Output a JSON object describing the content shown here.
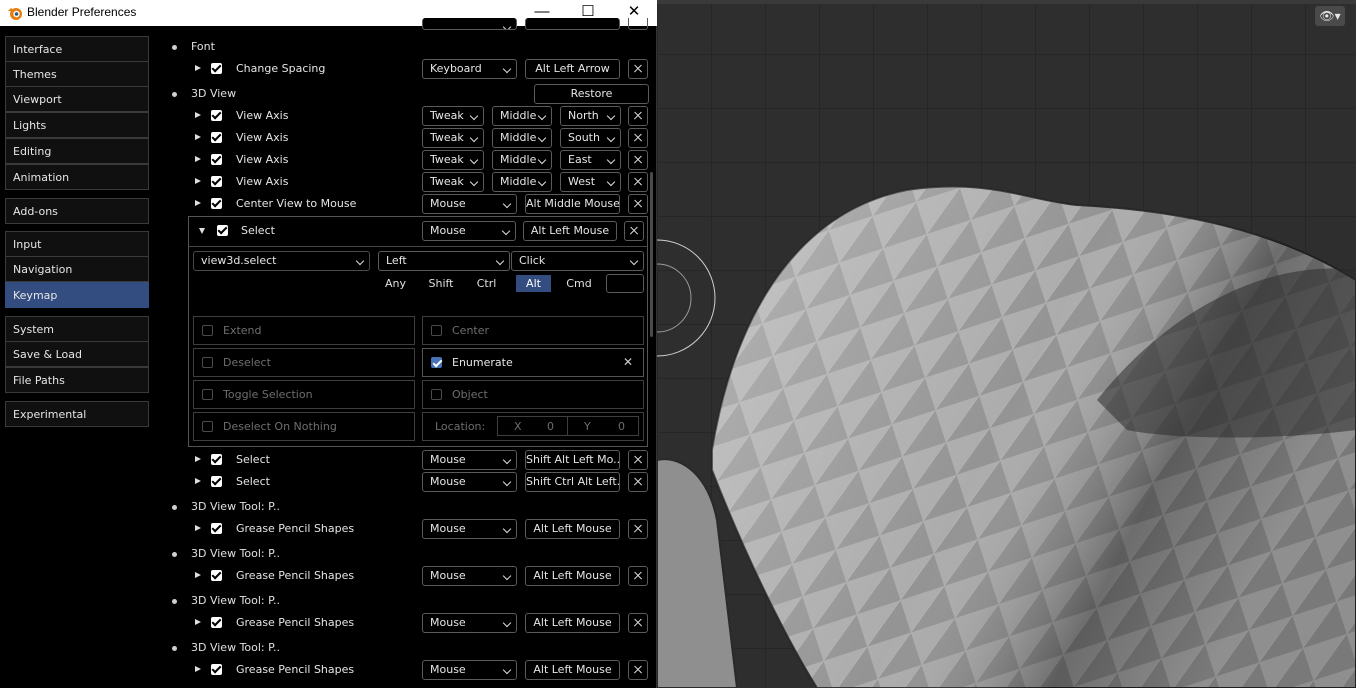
{
  "window": {
    "title": "Blender Preferences",
    "minimize": "—",
    "maximize": "☐",
    "close": "✕"
  },
  "sidebar": [
    {
      "label": "Interface"
    },
    {
      "label": "Themes"
    },
    {
      "label": "Viewport"
    },
    {
      "label": "Lights"
    },
    {
      "label": "Editing"
    },
    {
      "label": "Animation"
    },
    {
      "label": "Add-ons"
    },
    {
      "label": "Input"
    },
    {
      "label": "Navigation"
    },
    {
      "label": "Keymap",
      "active": true
    },
    {
      "label": "System"
    },
    {
      "label": "Save & Load"
    },
    {
      "label": "File Paths"
    },
    {
      "label": "Experimental"
    }
  ],
  "keymap": {
    "font": {
      "category": "Font",
      "item": {
        "name": "Change Spacing",
        "input": "Keyboard",
        "key": "Alt Left Arrow"
      }
    },
    "view3d": {
      "category": "3D View",
      "restore": "Restore",
      "items": [
        {
          "name": "View Axis",
          "input": "Tweak",
          "button": "Middle",
          "dir": "North"
        },
        {
          "name": "View Axis",
          "input": "Tweak",
          "button": "Middle",
          "dir": "South"
        },
        {
          "name": "View Axis",
          "input": "Tweak",
          "button": "Middle",
          "dir": "East"
        },
        {
          "name": "View Axis",
          "input": "Tweak",
          "button": "Middle",
          "dir": "West"
        },
        {
          "name": "Center View to Mouse",
          "input": "Mouse",
          "key": "Alt Middle Mouse"
        }
      ],
      "select_expanded": {
        "name": "Select",
        "input": "Mouse",
        "key": "Alt Left Mouse",
        "operator": "view3d.select",
        "mouse_button": "Left",
        "event": "Click",
        "modifiers": [
          "Any",
          "Shift",
          "Ctrl",
          "Alt",
          "Cmd"
        ],
        "active_modifier": "Alt",
        "props": {
          "extend": "Extend",
          "center": "Center",
          "deselect": "Deselect",
          "enumerate": "Enumerate",
          "toggle": "Toggle Selection",
          "object": "Object",
          "deselect_nothing": "Deselect On Nothing",
          "location": "Location:",
          "x_label": "X",
          "x_val": "0",
          "y_label": "Y",
          "y_val": "0"
        }
      },
      "after": [
        {
          "name": "Select",
          "input": "Mouse",
          "key": "Shift Alt Left Mo.."
        },
        {
          "name": "Select",
          "input": "Mouse",
          "key": "Shift Ctrl Alt Left..."
        }
      ]
    },
    "tools": [
      {
        "category": "3D View Tool: P..",
        "name": "Grease Pencil Shapes",
        "input": "Mouse",
        "key": "Alt Left Mouse"
      },
      {
        "category": "3D View Tool: P..",
        "name": "Grease Pencil Shapes",
        "input": "Mouse",
        "key": "Alt Left Mouse"
      },
      {
        "category": "3D View Tool: P..",
        "name": "Grease Pencil Shapes",
        "input": "Mouse",
        "key": "Alt Left Mouse"
      },
      {
        "category": "3D View Tool: P..",
        "name": "Grease Pencil Shapes",
        "input": "Mouse",
        "key": "Alt Left Mouse"
      }
    ]
  },
  "viewport": {
    "visibility_icon": "eye-icon"
  }
}
